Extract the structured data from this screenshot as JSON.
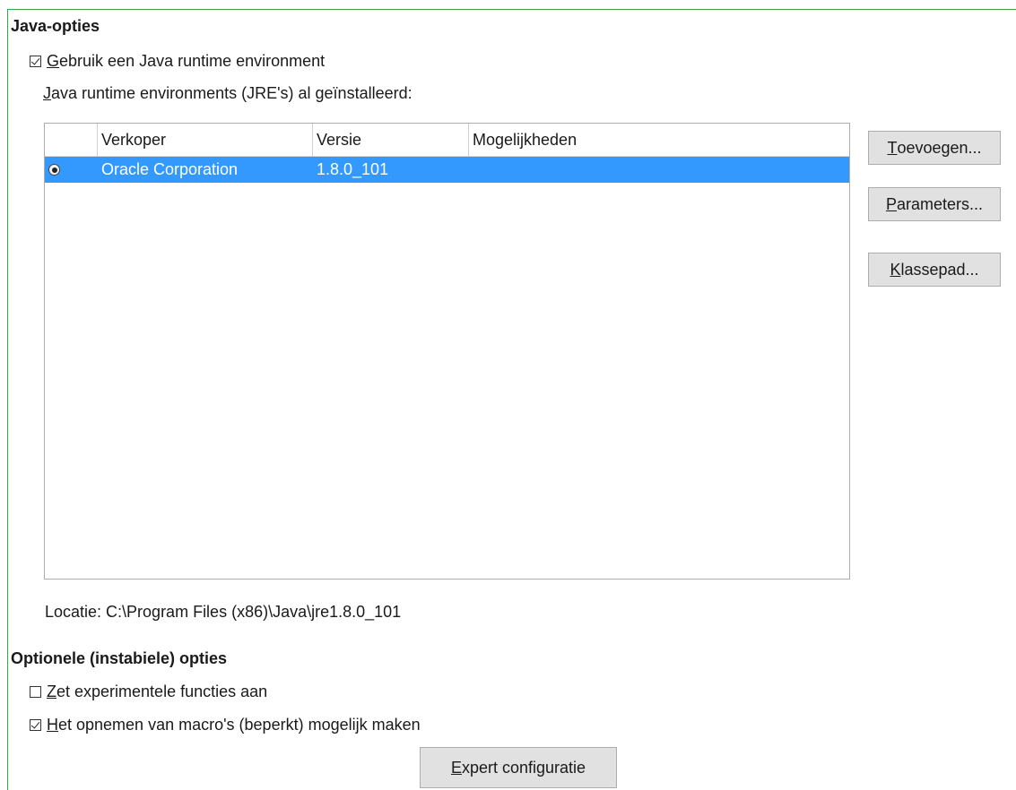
{
  "java_options": {
    "heading": "Java-opties",
    "use_jre": {
      "mnemonic": "G",
      "rest": "ebruik een Java runtime environment",
      "checked": true
    },
    "installed_label": {
      "mnemonic": "J",
      "rest": "ava runtime environments (JRE's) al geïnstalleerd:"
    },
    "table": {
      "columns": [
        "Verkoper",
        "Versie",
        "Mogelijkheden"
      ],
      "rows": [
        {
          "vendor": "Oracle Corporation",
          "version": "1.8.0_101",
          "features": "",
          "selected": true
        }
      ],
      "selection_color": "#3399ff"
    },
    "buttons": {
      "add": {
        "mnemonic": "T",
        "rest": "oevoegen..."
      },
      "parameters": {
        "mnemonic": "P",
        "rest": "arameters..."
      },
      "classpath": {
        "mnemonic": "K",
        "rest": "lassepad..."
      }
    },
    "location": "Locatie: C:\\Program Files (x86)\\Java\\jre1.8.0_101"
  },
  "optional_options": {
    "heading": "Optionele (instabiele) opties",
    "experimental": {
      "mnemonic": "Z",
      "rest": "et experimentele functies aan",
      "checked": false
    },
    "macro_recording": {
      "mnemonic": "H",
      "rest": "et opnemen van macro's (beperkt) mogelijk maken",
      "checked": true
    },
    "expert_button": {
      "mnemonic": "E",
      "rest": "xpert configuratie"
    }
  },
  "colors": {
    "frame_border": "#3fa63f",
    "button_bg": "#e1e1e1"
  }
}
